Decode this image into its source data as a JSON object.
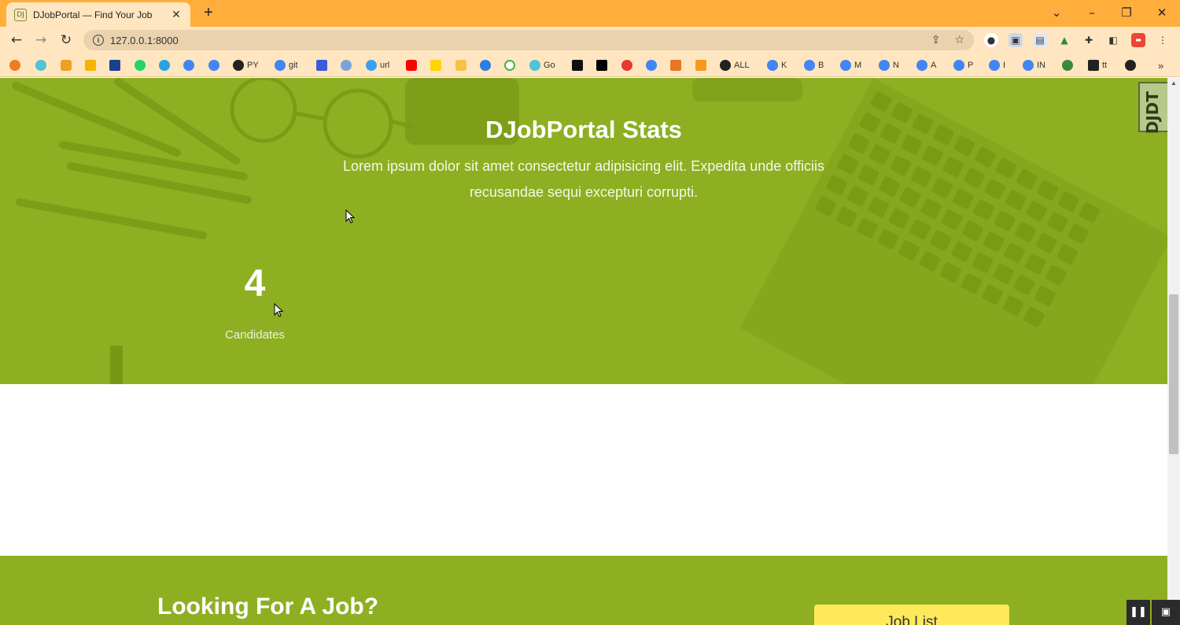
{
  "browser": {
    "tab_title": "DJobPortal — Find Your Job",
    "tab_favicon": "DJ",
    "tab_close": "✕",
    "new_tab": "+",
    "url": "127.0.0.1:8000",
    "bookmarks": [
      "PY",
      "git",
      "url",
      "Go",
      "ALL",
      "K",
      "B",
      "M",
      "N",
      "A",
      "P",
      "I",
      "IN",
      "tt"
    ],
    "bookmarks_more": "»"
  },
  "stats_section": {
    "title": "DJobPortal Stats",
    "description": "Lorem ipsum dolor sit amet consectetur adipisicing elit. Expedita unde officiis recusandae sequi excepturi corrupti.",
    "stat": {
      "number": "4",
      "label": "Candidates"
    }
  },
  "cta_section": {
    "title": "Looking For A Job?",
    "button_label": "Job List"
  },
  "debug_toolbar": {
    "label": "DJDT"
  },
  "colors": {
    "section_green": "#8eaf22",
    "cta_button": "#fde95a",
    "tab_bar": "#ffae3c",
    "toolbar": "#ffe6c0"
  }
}
